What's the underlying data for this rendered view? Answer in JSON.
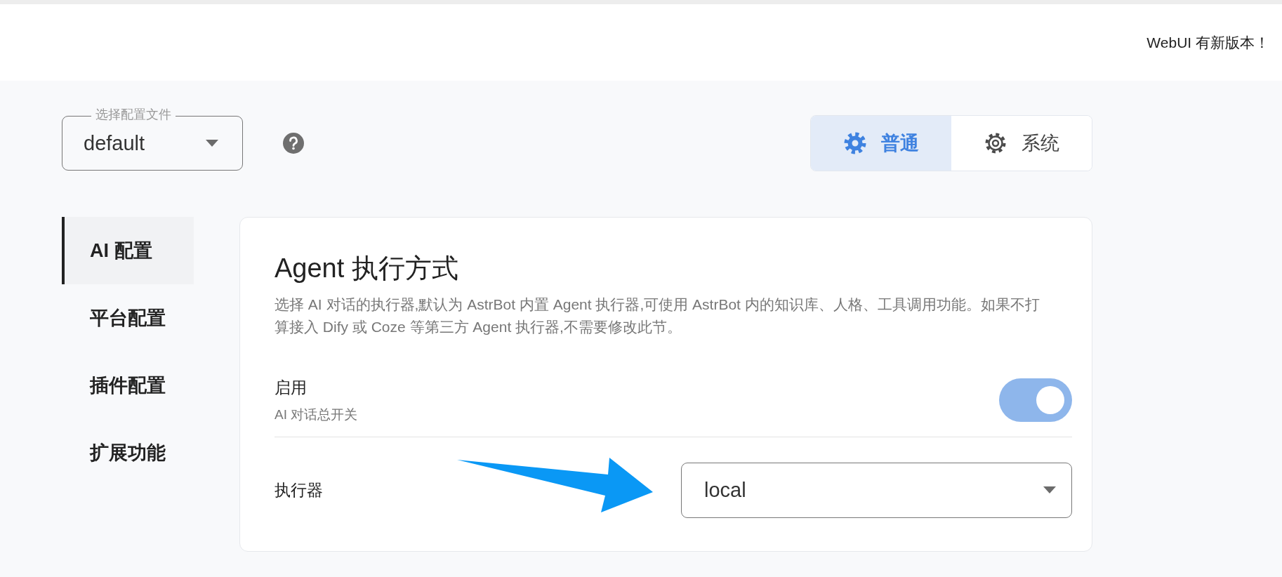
{
  "header": {
    "notice": "WebUI 有新版本！"
  },
  "config_select": {
    "label": "选择配置文件",
    "value": "default"
  },
  "mode_tabs": [
    {
      "label": "普通",
      "selected": true
    },
    {
      "label": "系统",
      "selected": false
    }
  ],
  "sidebar": {
    "items": [
      {
        "label": "AI 配置",
        "selected": true
      },
      {
        "label": "平台配置",
        "selected": false
      },
      {
        "label": "插件配置",
        "selected": false
      },
      {
        "label": "扩展功能",
        "selected": false
      }
    ]
  },
  "section": {
    "title": "Agent 执行方式",
    "description": "选择 AI 对话的执行器,默认为 AstrBot 内置 Agent 执行器,可使用 AstrBot 内的知识库、人格、工具调用功能。如果不打算接入 Dify 或 Coze 等第三方 Agent 执行器,不需要修改此节。",
    "settings": [
      {
        "kind": "switch",
        "label": "启用",
        "hint": "AI 对话总开关",
        "on": true
      },
      {
        "kind": "select",
        "label": "执行器",
        "value": "local"
      }
    ]
  }
}
